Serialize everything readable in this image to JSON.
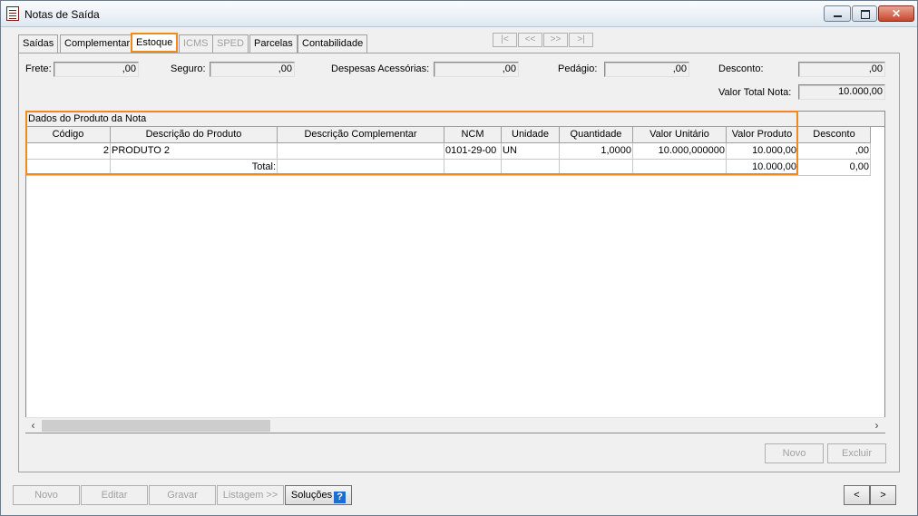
{
  "window": {
    "title": "Notas de Saída"
  },
  "tabs": [
    {
      "label": "Saídas",
      "state": "normal"
    },
    {
      "label": "Complementar",
      "state": "normal"
    },
    {
      "label": "Estoque",
      "state": "active"
    },
    {
      "label": "ICMS",
      "state": "disabled"
    },
    {
      "label": "SPED",
      "state": "disabled"
    },
    {
      "label": "Parcelas",
      "state": "normal"
    },
    {
      "label": "Contabilidade",
      "state": "normal"
    }
  ],
  "record_nav": {
    "first": "|<",
    "prev": "<<",
    "next": ">>",
    "last": ">|"
  },
  "fields": {
    "frete": {
      "label": "Frete:",
      "value": ",00"
    },
    "seguro": {
      "label": "Seguro:",
      "value": ",00"
    },
    "despesas": {
      "label": "Despesas Acessórias:",
      "value": ",00"
    },
    "pedagio": {
      "label": "Pedágio:",
      "value": ",00"
    },
    "desconto": {
      "label": "Desconto:",
      "value": ",00"
    },
    "valor_total": {
      "label": "Valor Total Nota:",
      "value": "10.000,00"
    }
  },
  "grid": {
    "caption": "Dados do Produto da Nota",
    "columns": [
      "Código",
      "Descrição do Produto",
      "Descrição Complementar",
      "NCM",
      "Unidade",
      "Quantidade",
      "Valor Unitário",
      "Valor Produto",
      "Desconto"
    ],
    "rows": [
      [
        "2",
        "PRODUTO 2",
        "",
        "0101-29-00",
        "UN",
        "1,0000",
        "10.000,000000",
        "10.000,00",
        ",00"
      ]
    ],
    "total": {
      "label": "Total:",
      "valor_produto": "10.000,00",
      "desconto": "0,00"
    }
  },
  "panel_buttons": {
    "novo": "Novo",
    "excluir": "Excluir"
  },
  "footer_buttons": {
    "novo": "Novo",
    "editar": "Editar",
    "gravar": "Gravar",
    "listagem": "Listagem >>",
    "solucoes": "Soluções"
  },
  "pager": {
    "prev": "<",
    "next": ">"
  },
  "colors": {
    "highlight": "#f08a1c",
    "help_icon": "#1c6fd0"
  }
}
